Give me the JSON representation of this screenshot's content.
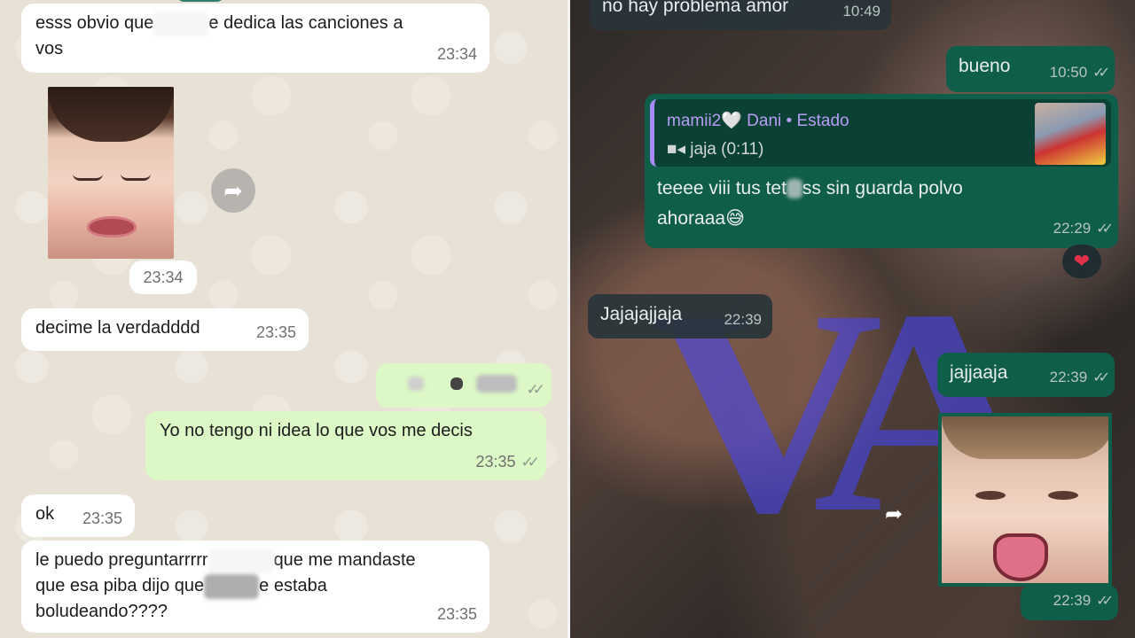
{
  "left_chat": {
    "messages": [
      {
        "dir": "in",
        "text": "esss obvio que",
        "text_after": "e dedica las canciones a",
        "text_line2": "vos",
        "time": "23:34"
      },
      {
        "dir": "in",
        "kind": "image",
        "time": "23:34"
      },
      {
        "dir": "in",
        "text": "decime la verdadddd",
        "time": "23:35"
      },
      {
        "dir": "out",
        "kind": "redacted",
        "ticks": "✓✓"
      },
      {
        "dir": "out",
        "text": "Yo no tengo ni idea lo que vos me decis",
        "time": "23:35",
        "ticks": "✓✓"
      },
      {
        "dir": "in",
        "text": "ok",
        "time": "23:35"
      },
      {
        "dir": "in",
        "text_l1a": "le puedo preguntarrrrr",
        "text_l1b": "que me mandaste",
        "text_l2a": "que esa piba dijo que",
        "text_l2b": "e estaba",
        "text_l3": "boludeando????",
        "time": "23:35"
      }
    ]
  },
  "right_chat": {
    "messages": [
      {
        "dir": "in",
        "text": "no hay problema amor",
        "time": "10:49"
      },
      {
        "dir": "out",
        "text": "bueno",
        "time": "10:50",
        "ticks": "✓✓"
      },
      {
        "dir": "out",
        "reply_name": "mamii2🤍 Dani • Estado",
        "reply_sub": "■◂ jaja (0:11)",
        "text_l1a": "teeee viii tus tet",
        "text_l1b": "ss sin guarda polvo",
        "text_l2": "ahoraaa😅",
        "time": "22:29",
        "ticks": "✓✓",
        "reaction": "❤"
      },
      {
        "dir": "in",
        "text": "Jajajajjaja",
        "time": "22:39"
      },
      {
        "dir": "out",
        "text": "jajjaaja",
        "time": "22:39",
        "ticks": "✓✓"
      },
      {
        "dir": "out",
        "kind": "image",
        "time": "22:39",
        "ticks": "✓✓"
      }
    ],
    "watermark": "VA"
  },
  "colors": {
    "left_bg": "#e8e1d6",
    "incoming_light": "#ffffff",
    "outgoing_light": "#dcf8c6",
    "incoming_dark": "#28343a",
    "outgoing_dark": "#0f5e4a",
    "reply_name": "#b79cf5"
  },
  "icons": {
    "forward": "forward-arrow-icon",
    "read_receipt": "double-check-icon",
    "reaction": "heart-icon"
  }
}
